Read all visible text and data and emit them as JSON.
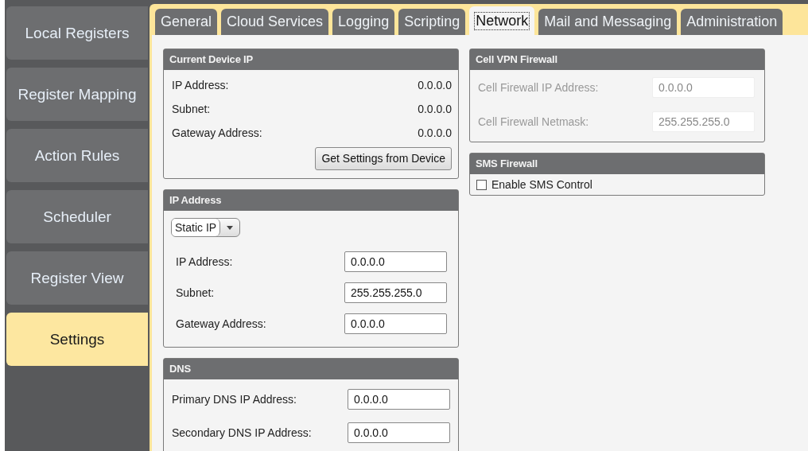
{
  "sidebar": {
    "items": [
      {
        "label": "Local Registers",
        "selected": false
      },
      {
        "label": "Register Mapping",
        "selected": false
      },
      {
        "label": "Action Rules",
        "selected": false
      },
      {
        "label": "Scheduler",
        "selected": false
      },
      {
        "label": "Register View",
        "selected": false
      },
      {
        "label": "Settings",
        "selected": true
      }
    ]
  },
  "tabs": [
    {
      "label": "General",
      "selected": false
    },
    {
      "label": "Cloud Services",
      "selected": false
    },
    {
      "label": "Logging",
      "selected": false
    },
    {
      "label": "Scripting",
      "selected": false
    },
    {
      "label": "Network",
      "selected": true
    },
    {
      "label": "Mail and Messaging",
      "selected": false
    },
    {
      "label": "Administration",
      "selected": false
    }
  ],
  "columns": [
    {
      "panels": [
        {
          "title": "Current Device IP",
          "kind": "readout",
          "rows": [
            {
              "kind": "readout",
              "label": "IP Address:",
              "value": "0.0.0.0"
            },
            {
              "kind": "readout",
              "label": "Subnet:",
              "value": "0.0.0.0"
            },
            {
              "kind": "readout",
              "label": "Gateway Address:",
              "value": "0.0.0.0"
            },
            {
              "kind": "button",
              "label": "Get Settings from Device"
            }
          ]
        },
        {
          "title": "IP Address",
          "kind": "form",
          "rows": [
            {
              "kind": "select",
              "value": "Static IP"
            },
            {
              "kind": "input",
              "label": "IP Address:",
              "value": "0.0.0.0",
              "disabled": false
            },
            {
              "kind": "input",
              "label": "Subnet:",
              "value": "255.255.255.0",
              "disabled": false
            },
            {
              "kind": "input",
              "label": "Gateway Address:",
              "value": "0.0.0.0",
              "disabled": false
            }
          ]
        },
        {
          "title": "DNS",
          "kind": "dns",
          "rows": [
            {
              "kind": "input",
              "label": "Primary DNS IP Address:",
              "value": "0.0.0.0",
              "disabled": false
            },
            {
              "kind": "input",
              "label": "Secondary DNS IP Address:",
              "value": "0.0.0.0",
              "disabled": false
            }
          ]
        }
      ]
    },
    {
      "panels": [
        {
          "title": "Cell VPN Firewall",
          "kind": "cell",
          "rows": [
            {
              "kind": "input",
              "label": "Cell Firewall IP Address:",
              "value": "0.0.0.0",
              "disabled": true
            },
            {
              "kind": "input",
              "label": "Cell Firewall Netmask:",
              "value": "255.255.255.0",
              "disabled": true
            }
          ]
        },
        {
          "title": "SMS Firewall",
          "kind": "check",
          "rows": [
            {
              "kind": "checkbox",
              "label": "Enable SMS Control",
              "checked": false
            }
          ]
        }
      ]
    }
  ]
}
